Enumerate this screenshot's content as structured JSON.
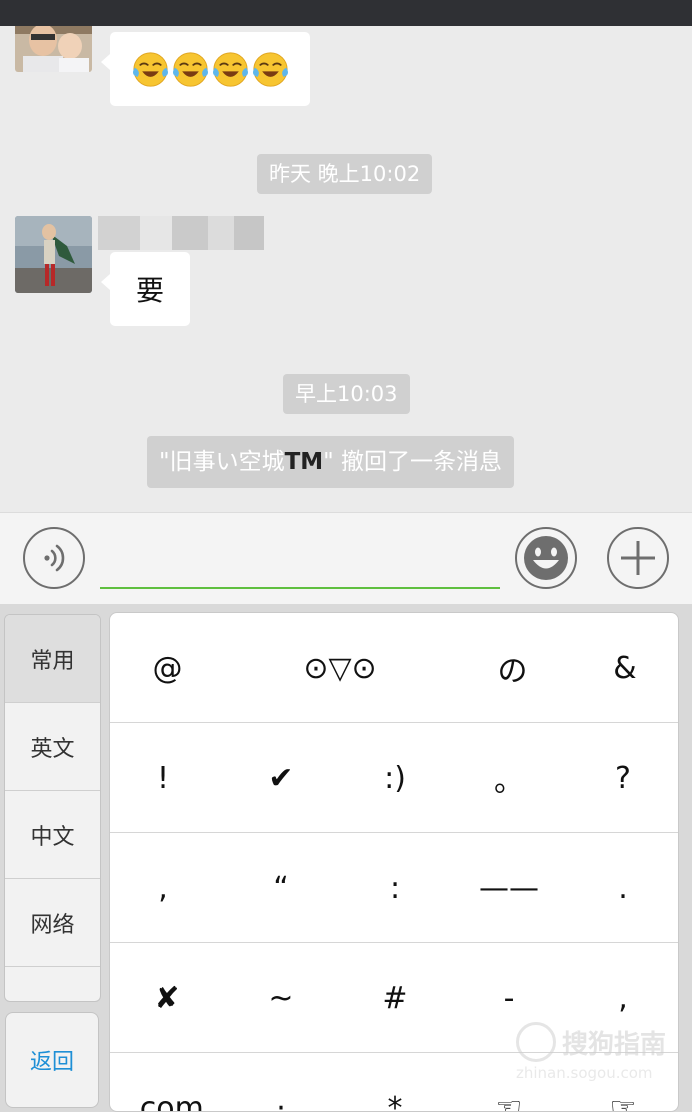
{
  "chat": {
    "messages": [
      {
        "type": "emoji_message",
        "emoji_count": 4,
        "emoji_name": "tears-of-joy-emoji"
      },
      {
        "type": "timestamp",
        "text": "昨天 晚上10:02"
      },
      {
        "type": "text_message",
        "text": "要"
      },
      {
        "type": "timestamp",
        "text": "早上10:03"
      },
      {
        "type": "system_notice",
        "prefix": "\"旧事い空城",
        "highlight": "TM",
        "suffix": "\" 撤回了一条消息"
      }
    ]
  },
  "input_bar": {
    "value": "",
    "accent_color": "#5fbf3f",
    "icons": [
      "voice-icon",
      "smiley-icon",
      "plus-icon"
    ]
  },
  "keyboard": {
    "categories": [
      "常用",
      "英文",
      "中文",
      "网络"
    ],
    "active_category": "常用",
    "back_label": "返回",
    "back_color": "#1e8fd6",
    "rows": [
      [
        "@",
        "⊙▽⊙",
        "の",
        "&"
      ],
      [
        "!",
        "✔",
        ":)",
        "。",
        "?"
      ],
      [
        ",",
        "“",
        ":",
        "——",
        "."
      ],
      [
        "✘",
        "~",
        "#",
        "-",
        ","
      ],
      [
        ".com",
        "·",
        "*",
        "☜",
        "☞"
      ]
    ]
  },
  "watermark": {
    "main": "搜狗指南",
    "sub": "zhinan.sogou.com"
  }
}
